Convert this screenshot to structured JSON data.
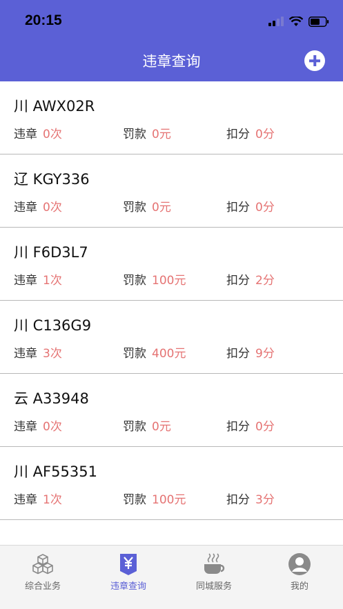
{
  "status": {
    "time": "20:15"
  },
  "header": {
    "title": "违章查询"
  },
  "list": {
    "items": [
      {
        "plate": "川 AWX02R",
        "violations_label": "违章",
        "violations": "0次",
        "fine_label": "罚款",
        "fine": "0元",
        "points_label": "扣分",
        "points": "0分"
      },
      {
        "plate": "辽 KGY336",
        "violations_label": "违章",
        "violations": "0次",
        "fine_label": "罚款",
        "fine": "0元",
        "points_label": "扣分",
        "points": "0分"
      },
      {
        "plate": "川 F6D3L7",
        "violations_label": "违章",
        "violations": "1次",
        "fine_label": "罚款",
        "fine": "100元",
        "points_label": "扣分",
        "points": "2分"
      },
      {
        "plate": "川 C136G9",
        "violations_label": "违章",
        "violations": "3次",
        "fine_label": "罚款",
        "fine": "400元",
        "points_label": "扣分",
        "points": "9分"
      },
      {
        "plate": "云 A33948",
        "violations_label": "违章",
        "violations": "0次",
        "fine_label": "罚款",
        "fine": "0元",
        "points_label": "扣分",
        "points": "0分"
      },
      {
        "plate": "川 AF55351",
        "violations_label": "违章",
        "violations": "1次",
        "fine_label": "罚款",
        "fine": "100元",
        "points_label": "扣分",
        "points": "3分"
      }
    ]
  },
  "tabbar": {
    "tabs": [
      {
        "label": "综合业务",
        "icon": "cubes-icon"
      },
      {
        "label": "违章查询",
        "icon": "yen-tag-icon"
      },
      {
        "label": "同城服务",
        "icon": "coffee-cup-icon"
      },
      {
        "label": "我的",
        "icon": "user-avatar-icon"
      }
    ]
  },
  "colors": {
    "primary": "#5b60d6",
    "value_red": "#e57373"
  }
}
